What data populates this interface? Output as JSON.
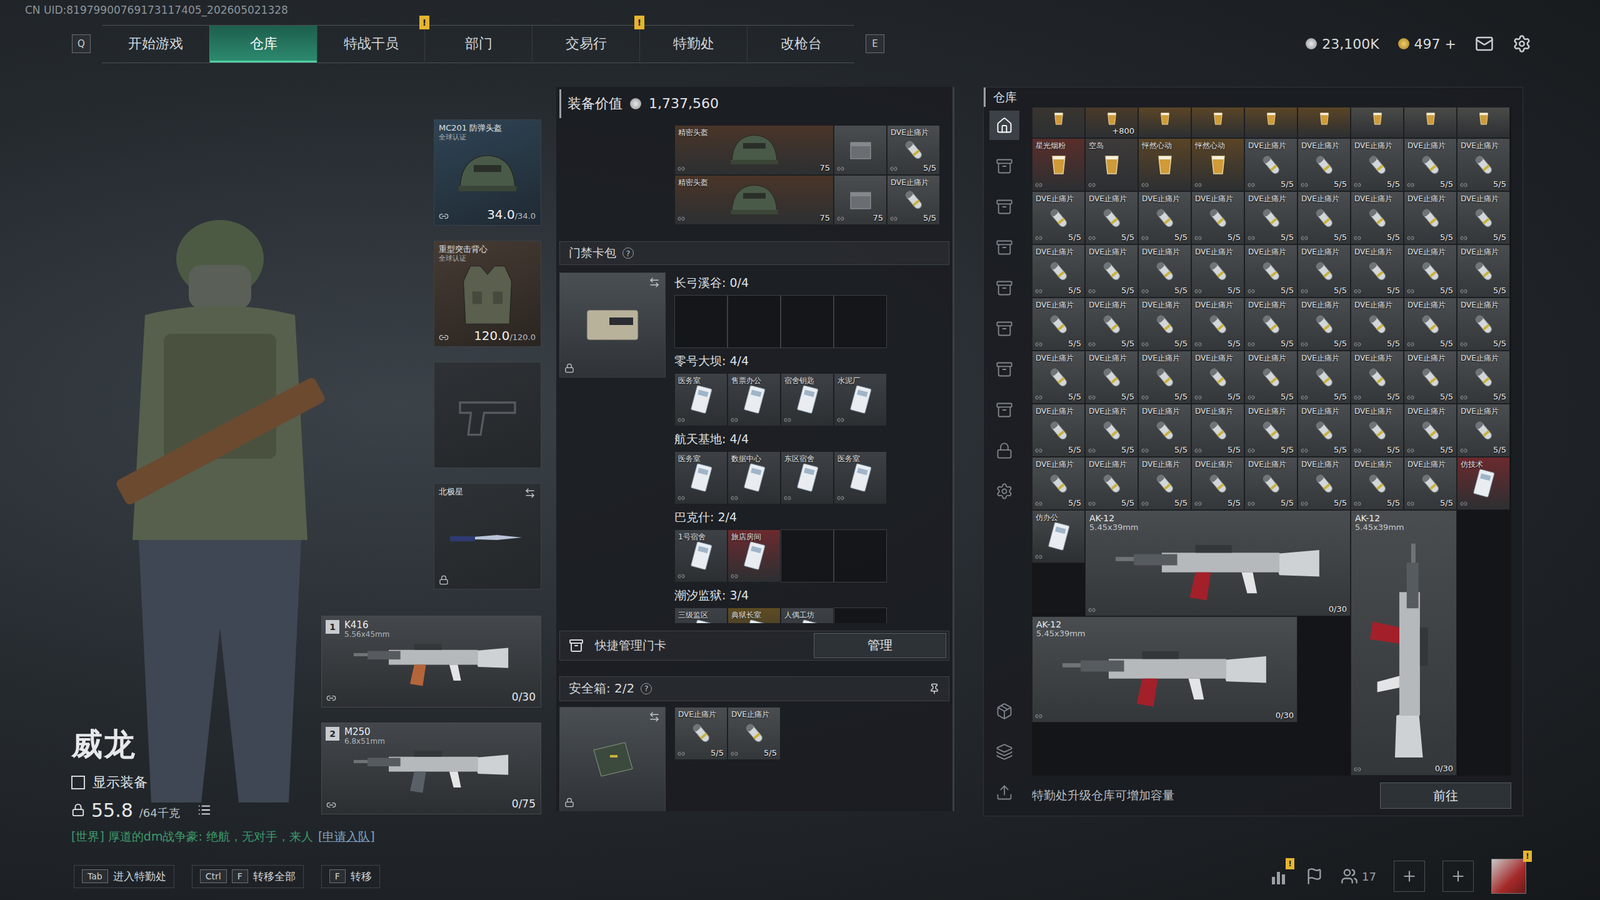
{
  "header": {
    "uid": "CN UID:81979900769173117405_202605021328",
    "prevKey": "Q",
    "nextKey": "E",
    "tabs": [
      {
        "label": "开始游戏",
        "selected": false,
        "badge": ""
      },
      {
        "label": "仓库",
        "selected": true,
        "badge": ""
      },
      {
        "label": "特战干员",
        "selected": false,
        "badge": ""
      },
      {
        "label": "部门",
        "selected": false,
        "badge": "!"
      },
      {
        "label": "交易行",
        "selected": false,
        "badge": ""
      },
      {
        "label": "特勤处",
        "selected": false,
        "badge": "!"
      },
      {
        "label": "改枪台",
        "selected": false,
        "badge": ""
      }
    ],
    "silver": "23,100K",
    "gold": "497",
    "goldAdd": "+"
  },
  "character": {
    "name": "威龙",
    "showGear": {
      "label": "显示装备",
      "checked": false
    },
    "weight": "55.8",
    "weightMax": "/64千克"
  },
  "chat": {
    "text": "[世界] 厚道的dm战争豪: 绝航，无对手，来人",
    "link": "[申请入队]"
  },
  "gear": [
    {
      "kind": "helmet",
      "name": "MC201 防弹头盔",
      "sub": "全球认证",
      "value": "34.0",
      "max": "/34.0"
    },
    {
      "kind": "armor",
      "name": "重型突击背心",
      "sub": "全球认证",
      "value": "120.0",
      "max": "/120.0"
    },
    {
      "kind": "pistol",
      "name": "",
      "sub": "",
      "value": "",
      "max": ""
    },
    {
      "kind": "melee",
      "name": "北极星",
      "sub": "",
      "value": "",
      "max": ""
    }
  ],
  "weapons": [
    {
      "slot": "1",
      "name": "K416",
      "caliber": "5.56x45mm",
      "ammo": "0/30",
      "color": "#b5653a"
    },
    {
      "slot": "2",
      "name": "M250",
      "caliber": "6.8x51mm",
      "ammo": "0/75",
      "color": "#5a6068"
    }
  ],
  "loadout": {
    "valueLabel": "装备价值",
    "value": "1,737,560",
    "backpack": [
      {
        "kind": "helmet",
        "name": "精密头盔",
        "count": "75",
        "color": "#4a3528"
      },
      {
        "kind": "crate",
        "name": "",
        "count": ""
      },
      {
        "kind": "dve",
        "name": "DVE止痛片",
        "count": "5/5"
      },
      {
        "kind": "helmet",
        "name": "精密头盔",
        "count": "75",
        "color": "#4a3528"
      },
      {
        "kind": "crate",
        "name": "",
        "count": "75"
      },
      {
        "kind": "dve",
        "name": "DVE止痛片",
        "count": "5/5"
      }
    ],
    "keycards": {
      "title": "门禁卡包",
      "help": "?",
      "groups": [
        {
          "title": "长弓溪谷: 0/4",
          "capacity": 4,
          "cards": []
        },
        {
          "title": "零号大坝: 4/4",
          "capacity": 4,
          "cards": [
            {
              "name": "医务室",
              "color": "#3d4146"
            },
            {
              "name": "售票办公",
              "color": "#3d4146"
            },
            {
              "name": "宿舍钥匙",
              "color": "#3d4146"
            },
            {
              "name": "水泥厂",
              "color": "#3d4146"
            }
          ]
        },
        {
          "title": "航天基地: 4/4",
          "capacity": 4,
          "cards": [
            {
              "name": "医务室",
              "color": "#3d4146"
            },
            {
              "name": "数据中心",
              "color": "#3d4146"
            },
            {
              "name": "东区宿舍",
              "color": "#3d4146"
            },
            {
              "name": "医务室",
              "color": "#3d4146"
            }
          ]
        },
        {
          "title": "巴克什: 2/4",
          "capacity": 4,
          "cards": [
            {
              "name": "1号宿舍",
              "color": "#3d4146"
            },
            {
              "name": "旅店房间",
              "color": "#6b2a2e"
            }
          ]
        },
        {
          "title": "潮汐监狱: 3/4",
          "capacity": 4,
          "cards": [
            {
              "name": "三级监区",
              "color": "#3d4146"
            },
            {
              "name": "典狱长室",
              "color": "#5e4c22"
            },
            {
              "name": "人偶工坊",
              "color": "#3d4146"
            }
          ]
        }
      ]
    },
    "quick": {
      "label": "快捷管理门卡",
      "button": "管理"
    },
    "safe": {
      "label": "安全箱:",
      "count": "2/2",
      "help": "?",
      "items": [
        {
          "kind": "dve",
          "name": "DVE止痛片",
          "count": "5/5"
        },
        {
          "kind": "dve",
          "name": "DVE止痛片",
          "count": "5/5"
        }
      ]
    }
  },
  "warehouse": {
    "title": "仓库",
    "sidebarTop": [
      {
        "kind": "home",
        "selected": true
      },
      {
        "kind": "rack",
        "selected": false
      },
      {
        "kind": "rack",
        "selected": false
      },
      {
        "kind": "rack",
        "selected": false
      },
      {
        "kind": "rack",
        "selected": false
      },
      {
        "kind": "rack",
        "selected": false
      },
      {
        "kind": "rack",
        "selected": false
      },
      {
        "kind": "rack",
        "selected": false
      },
      {
        "kind": "lock",
        "selected": false
      },
      {
        "kind": "gear",
        "selected": false
      }
    ],
    "sidebarBottom": [
      {
        "kind": "box",
        "selected": false
      },
      {
        "kind": "layers",
        "selected": false
      },
      {
        "kind": "transfer",
        "selected": false
      }
    ],
    "items": [
      {
        "kind": "partial",
        "name": "",
        "count": "",
        "color": "#3a3530"
      },
      {
        "kind": "partial",
        "name": "",
        "count": "+800",
        "color": "#4a3a2a"
      },
      {
        "kind": "partial",
        "name": "",
        "count": "",
        "color": "#5a4426"
      },
      {
        "kind": "partial",
        "name": "",
        "count": "",
        "color": "#5a4426"
      },
      {
        "kind": "partial",
        "name": "",
        "count": "",
        "color": "#5a4426"
      },
      {
        "kind": "partial",
        "name": "",
        "count": "",
        "color": "#5a4426"
      },
      {
        "kind": "partial",
        "name": "",
        "count": "",
        "color": "#4a4a48"
      },
      {
        "kind": "partial",
        "name": "",
        "count": "",
        "color": "#4a4a48"
      },
      {
        "kind": "partial",
        "name": "",
        "count": "",
        "color": "#4a4a48"
      },
      {
        "kind": "drink",
        "name": "星光烟粉",
        "count": "",
        "color": "#5a2e2a"
      },
      {
        "kind": "drink",
        "name": "空岛",
        "count": "",
        "color": "#3e3a3a"
      },
      {
        "kind": "drink",
        "name": "怦然心动",
        "count": "",
        "color": "#5a4426"
      },
      {
        "kind": "drink",
        "name": "怦然心动",
        "count": "",
        "color": "#5a4426"
      },
      {
        "kind": "dve",
        "name": "DVE止痛片",
        "count": "5/5"
      },
      {
        "kind": "dve",
        "name": "DVE止痛片",
        "count": "5/5"
      },
      {
        "kind": "dve",
        "name": "DVE止痛片",
        "count": "5/5"
      },
      {
        "kind": "dve",
        "name": "DVE止痛片",
        "count": "5/5"
      },
      {
        "kind": "dve",
        "name": "DVE止痛片",
        "count": "5/5"
      },
      {
        "kind": "dve",
        "name": "DVE止痛片",
        "count": "5/5"
      },
      {
        "kind": "dve",
        "name": "DVE止痛片",
        "count": "5/5"
      },
      {
        "kind": "dve",
        "name": "DVE止痛片",
        "count": "5/5"
      },
      {
        "kind": "dve",
        "name": "DVE止痛片",
        "count": "5/5"
      },
      {
        "kind": "dve",
        "name": "DVE止痛片",
        "count": "5/5"
      },
      {
        "kind": "dve",
        "name": "DVE止痛片",
        "count": "5/5"
      },
      {
        "kind": "dve",
        "name": "DVE止痛片",
        "count": "5/5"
      },
      {
        "kind": "dve",
        "name": "DVE止痛片",
        "count": "5/5"
      },
      {
        "kind": "dve",
        "name": "DVE止痛片",
        "count": "5/5"
      },
      {
        "kind": "dve",
        "name": "DVE止痛片",
        "count": "5/5"
      },
      {
        "kind": "dve",
        "name": "DVE止痛片",
        "count": "5/5"
      },
      {
        "kind": "dve",
        "name": "DVE止痛片",
        "count": "5/5"
      },
      {
        "kind": "dve",
        "name": "DVE止痛片",
        "count": "5/5"
      },
      {
        "kind": "dve",
        "name": "DVE止痛片",
        "count": "5/5"
      },
      {
        "kind": "dve",
        "name": "DVE止痛片",
        "count": "5/5"
      },
      {
        "kind": "dve",
        "name": "DVE止痛片",
        "count": "5/5"
      },
      {
        "kind": "dve",
        "name": "DVE止痛片",
        "count": "5/5"
      },
      {
        "kind": "dve",
        "name": "DVE止痛片",
        "count": "5/5"
      },
      {
        "kind": "dve",
        "name": "DVE止痛片",
        "count": "5/5"
      },
      {
        "kind": "dve",
        "name": "DVE止痛片",
        "count": "5/5"
      },
      {
        "kind": "dve",
        "name": "DVE止痛片",
        "count": "5/5"
      },
      {
        "kind": "dve",
        "name": "DVE止痛片",
        "count": "5/5"
      },
      {
        "kind": "dve",
        "name": "DVE止痛片",
        "count": "5/5"
      },
      {
        "kind": "dve",
        "name": "DVE止痛片",
        "count": "5/5"
      },
      {
        "kind": "dve",
        "name": "DVE止痛片",
        "count": "5/5"
      },
      {
        "kind": "dve",
        "name": "DVE止痛片",
        "count": "5/5"
      },
      {
        "kind": "dve",
        "name": "DVE止痛片",
        "count": "5/5"
      },
      {
        "kind": "dve",
        "name": "DVE止痛片",
        "count": "5/5"
      },
      {
        "kind": "dve",
        "name": "DVE止痛片",
        "count": "5/5"
      },
      {
        "kind": "dve",
        "name": "DVE止痛片",
        "count": "5/5"
      },
      {
        "kind": "dve",
        "name": "DVE止痛片",
        "count": "5/5"
      },
      {
        "kind": "dve",
        "name": "DVE止痛片",
        "count": "5/5"
      },
      {
        "kind": "dve",
        "name": "DVE止痛片",
        "count": "5/5"
      },
      {
        "kind": "dve",
        "name": "DVE止痛片",
        "count": "5/5"
      },
      {
        "kind": "dve",
        "name": "DVE止痛片",
        "count": "5/5"
      },
      {
        "kind": "dve",
        "name": "DVE止痛片",
        "count": "5/5"
      },
      {
        "kind": "dve",
        "name": "DVE止痛片",
        "count": "5/5"
      },
      {
        "kind": "dve",
        "name": "DVE止痛片",
        "count": "5/5"
      },
      {
        "kind": "dve",
        "name": "DVE止痛片",
        "count": "5/5"
      },
      {
        "kind": "dve",
        "name": "DVE止痛片",
        "count": "5/5"
      },
      {
        "kind": "dve",
        "name": "DVE止痛片",
        "count": "5/5"
      },
      {
        "kind": "dve",
        "name": "DVE止痛片",
        "count": "5/5"
      },
      {
        "kind": "dve",
        "name": "DVE止痛片",
        "count": "5/5"
      },
      {
        "kind": "dve",
        "name": "DVE止痛片",
        "count": "5/5"
      },
      {
        "kind": "dve",
        "name": "DVE止痛片",
        "count": "5/5"
      },
      {
        "kind": "dve",
        "name": "DVE止痛片",
        "count": "5/5"
      },
      {
        "kind": "dve",
        "name": "DVE止痛片",
        "count": "5/5"
      },
      {
        "kind": "dve",
        "name": "DVE止痛片",
        "count": "5/5"
      },
      {
        "kind": "dve",
        "name": "DVE止痛片",
        "count": "5/5"
      },
      {
        "kind": "dve",
        "name": "DVE止痛片",
        "count": "5/5"
      },
      {
        "kind": "dve",
        "name": "DVE止痛片",
        "count": "5/5"
      },
      {
        "kind": "dve",
        "name": "DVE止痛片",
        "count": "5/5"
      },
      {
        "kind": "dve",
        "name": "DVE止痛片",
        "count": "5/5"
      },
      {
        "kind": "card",
        "name": "仿技术",
        "count": "",
        "color": "#6b2a2e"
      },
      {
        "kind": "card",
        "name": "仿办公",
        "count": "",
        "color": "#45484b"
      },
      {
        "kind": "rifle-h",
        "name": "AK-12",
        "caliber": "5.45x39mm",
        "count": "0/30"
      },
      {
        "kind": "rifle-v",
        "name": "AK-12",
        "caliber": "5.45x39mm",
        "count": "0/30"
      },
      {
        "kind": "rifle-h",
        "name": "AK-12",
        "caliber": "5.45x39mm",
        "count": "0/30"
      }
    ],
    "upgradeText": "特勤处升级仓库可增加容量",
    "button": "前往"
  },
  "bottomBar": {
    "hints": [
      {
        "keys": [
          "Tab"
        ],
        "label": "进入特勤处"
      },
      {
        "keys": [
          "Ctrl",
          "F"
        ],
        "label": "转移全部"
      },
      {
        "keys": [
          "F"
        ],
        "label": "转移"
      }
    ],
    "statsBadge": "!",
    "friends": "17",
    "avatarBadge": "!"
  }
}
